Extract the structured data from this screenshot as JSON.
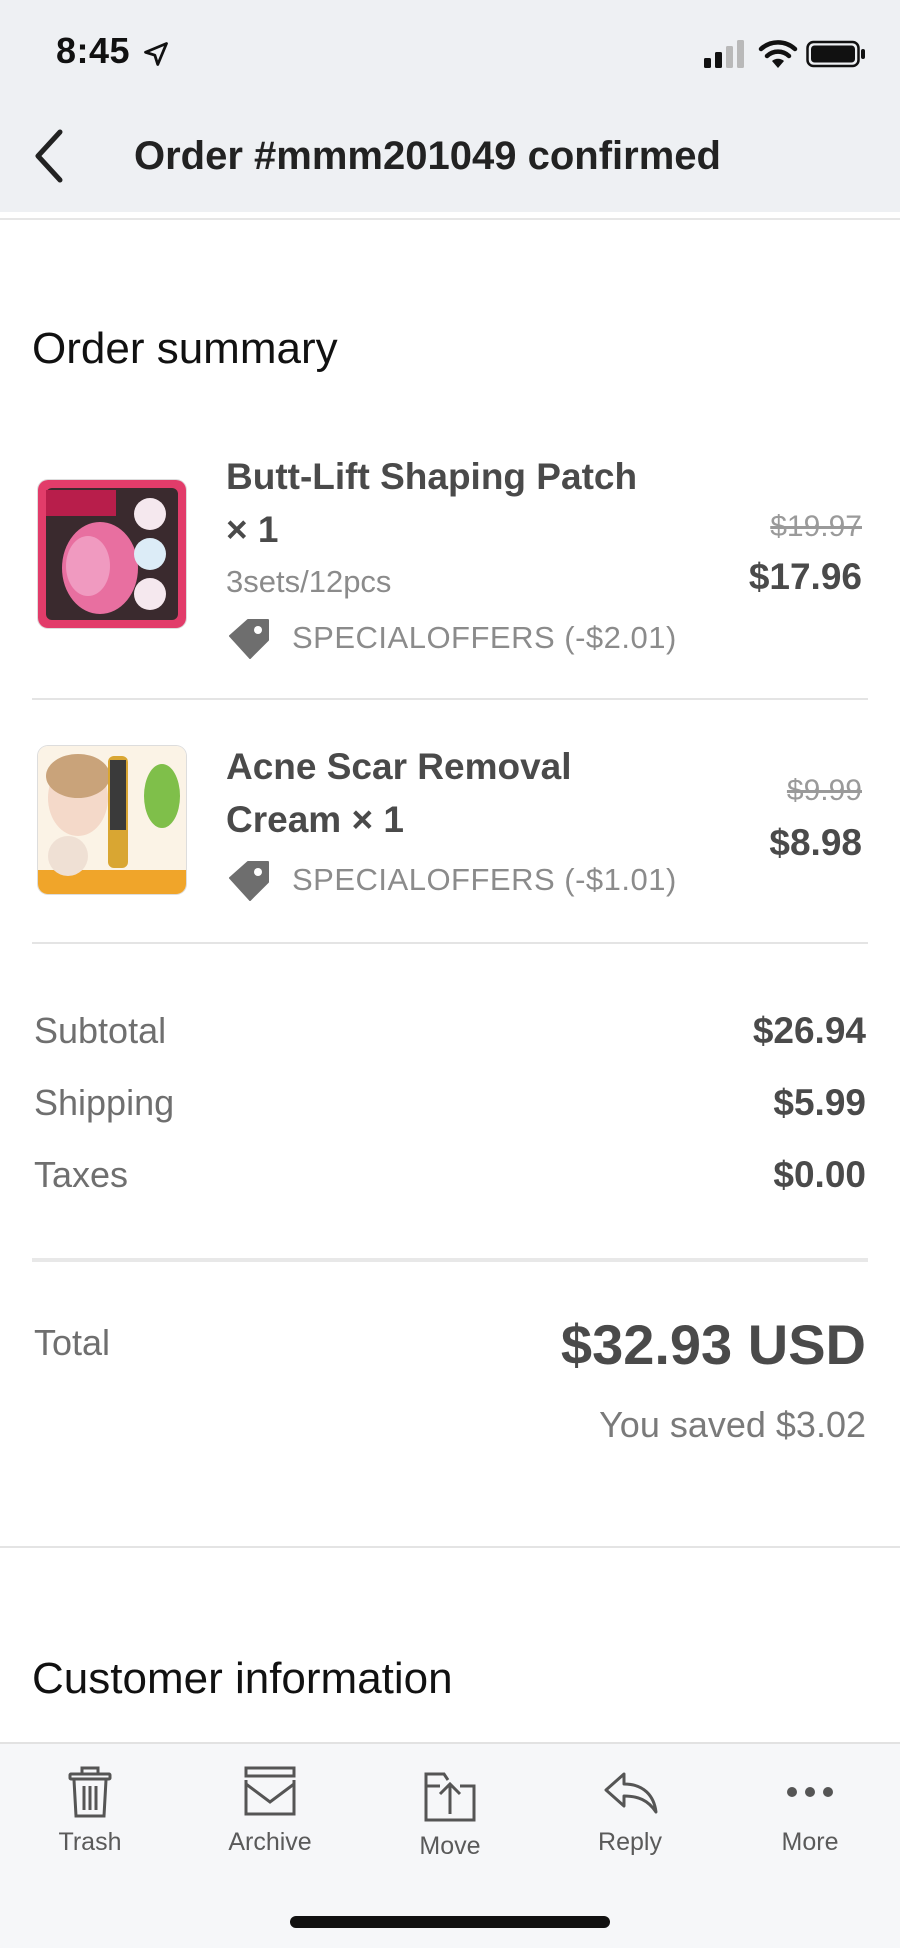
{
  "status_bar": {
    "time": "8:45"
  },
  "nav": {
    "title": "Order #mmm201049 confirmed"
  },
  "order_summary": {
    "heading": "Order summary",
    "items": [
      {
        "name": "Butt-Lift Shaping Patch × 1",
        "variant": "3sets/12pcs",
        "discount": "SPECIALOFFERS (-$2.01)",
        "original_price": "$19.97",
        "price": "$17.96"
      },
      {
        "name": "Acne Scar Removal Cream × 1",
        "variant": "",
        "discount": "SPECIALOFFERS (-$1.01)",
        "original_price": "$9.99",
        "price": "$8.98"
      }
    ],
    "subtotal_label": "Subtotal",
    "subtotal": "$26.94",
    "shipping_label": "Shipping",
    "shipping": "$5.99",
    "taxes_label": "Taxes",
    "taxes": "$0.00",
    "total_label": "Total",
    "total": "$32.93 USD",
    "saved": "You saved $3.02"
  },
  "customer_information": {
    "heading": "Customer information"
  },
  "toolbar": {
    "trash_label": "Trash",
    "archive_label": "Archive",
    "move_label": "Move",
    "reply_label": "Reply",
    "more_label": "More"
  },
  "icons": {
    "back": "chevron-left-icon",
    "location": "location-arrow-icon",
    "signal": "cellular-signal-icon",
    "wifi": "wifi-icon",
    "battery": "battery-icon",
    "tag": "price-tag-icon",
    "trash": "trash-icon",
    "archive": "archive-icon",
    "move": "move-icon",
    "reply": "reply-icon",
    "more": "more-dots-icon"
  },
  "colors": {
    "chrome_bg": "#eef0f3",
    "text_primary": "#4a4a4a",
    "text_secondary": "#8b8b8b",
    "toolbar_bg": "#f6f7f9"
  }
}
